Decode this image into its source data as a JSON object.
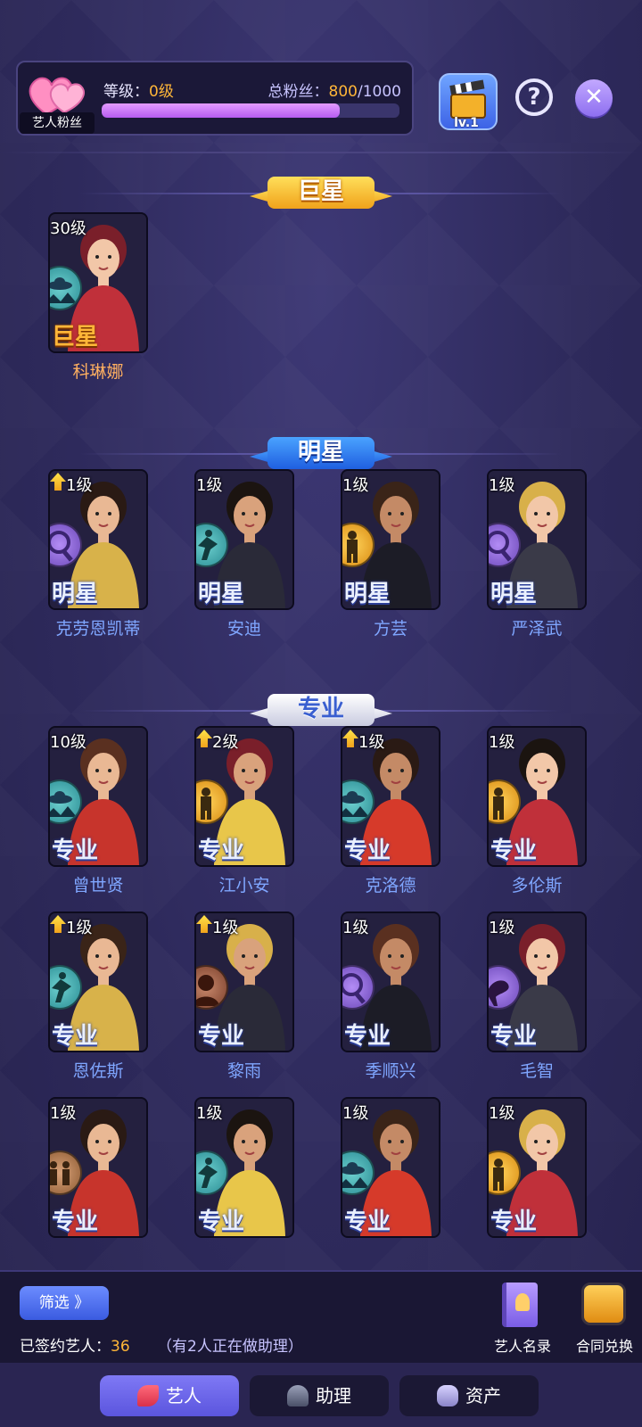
{
  "header": {
    "fan_badge": "艺人粉丝",
    "level_label": "等级：",
    "level_value": "0级",
    "fans_label": "总粉丝：",
    "fans_current": "800",
    "fans_total": "/1000",
    "fans_progress": 0.8,
    "clapper_level": "lv.1",
    "help_symbol": "?",
    "close_symbol": "✕"
  },
  "sections": {
    "superstar": "巨星",
    "star": "明星",
    "pro": "专业"
  },
  "superstars": [
    {
      "level": "30级",
      "rank": "巨星",
      "name": "科琳娜",
      "up": false,
      "skill": "ufo-icon",
      "skill_color": "teal"
    }
  ],
  "stars": [
    {
      "level": "1级",
      "rank": "明星",
      "name": "克劳恩凯蒂",
      "up": true,
      "skill": "magnifier-icon",
      "skill_color": "purple"
    },
    {
      "level": "1级",
      "rank": "明星",
      "name": "安迪",
      "up": false,
      "skill": "dancer-icon",
      "skill_color": "teal"
    },
    {
      "level": "1级",
      "rank": "明星",
      "name": "方芸",
      "up": false,
      "skill": "soldier-icon",
      "skill_color": "gold"
    },
    {
      "level": "1级",
      "rank": "明星",
      "name": "严泽武",
      "up": false,
      "skill": "magnifier-icon",
      "skill_color": "purple"
    }
  ],
  "pros": [
    {
      "level": "10级",
      "rank": "专业",
      "name": "曾世贤",
      "up": false,
      "skill": "ufo-icon",
      "skill_color": "teal"
    },
    {
      "level": "2级",
      "rank": "专业",
      "name": "江小安",
      "up": true,
      "skill": "soldier-icon",
      "skill_color": "gold"
    },
    {
      "level": "1级",
      "rank": "专业",
      "name": "克洛德",
      "up": true,
      "skill": "ufo-icon",
      "skill_color": "teal"
    },
    {
      "level": "1级",
      "rank": "专业",
      "name": "多伦斯",
      "up": false,
      "skill": "soldier-icon",
      "skill_color": "gold"
    },
    {
      "level": "1级",
      "rank": "专业",
      "name": "恩佐斯",
      "up": true,
      "skill": "dancer-icon",
      "skill_color": "teal"
    },
    {
      "level": "1级",
      "rank": "专业",
      "name": "黎雨",
      "up": true,
      "skill": "bust-icon",
      "skill_color": "brown"
    },
    {
      "level": "1级",
      "rank": "专业",
      "name": "季顺兴",
      "up": false,
      "skill": "magnifier-icon",
      "skill_color": "purple"
    },
    {
      "level": "1级",
      "rank": "专业",
      "name": "毛智",
      "up": false,
      "skill": "flamingo-icon",
      "skill_color": "purple"
    },
    {
      "level": "1级",
      "rank": "专业",
      "name": "",
      "up": false,
      "skill": "family-icon",
      "skill_color": "tan"
    },
    {
      "level": "1级",
      "rank": "专业",
      "name": "",
      "up": false,
      "skill": "dancer-icon",
      "skill_color": "teal"
    },
    {
      "level": "1级",
      "rank": "专业",
      "name": "",
      "up": false,
      "skill": "ufo-icon",
      "skill_color": "teal"
    },
    {
      "level": "1级",
      "rank": "专业",
      "name": "",
      "up": false,
      "skill": "soldier-icon",
      "skill_color": "gold"
    }
  ],
  "bottom": {
    "filter_label": "筛选 》",
    "signed_label": "已签约艺人：",
    "signed_count": "36",
    "assist_note": "（有2人正在做助理）",
    "roster_label": "艺人名录",
    "contract_label": "合同兑换"
  },
  "nav": {
    "tabs": [
      {
        "label": "艺人",
        "active": true
      },
      {
        "label": "助理",
        "active": false
      },
      {
        "label": "资产",
        "active": false
      }
    ]
  }
}
